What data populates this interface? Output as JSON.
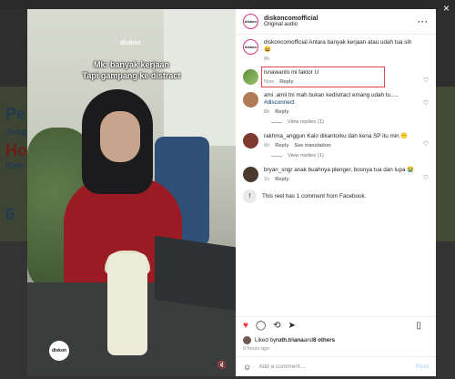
{
  "background": {
    "left_text": [
      "Pe",
      "Jang",
      "Hos",
      "Kam",
      "6"
    ]
  },
  "close_icon": "×",
  "video": {
    "logo_top": "diskon",
    "caption_line1": "Mk: banyak kerjaan",
    "caption_line2": "Tapi gampang ke distract",
    "logo_bottom": "diskon"
  },
  "header": {
    "username": "diskoncomofficial",
    "audio": "Original audio",
    "more": "···"
  },
  "comments": [
    {
      "avatar": "diskon",
      "avatar_style": "",
      "text_user": "diskoncomofficial",
      "text": "Antara banyak kerjaan atau udah tua sih 😆",
      "time": "9h",
      "reply": "",
      "translate": "",
      "liked": false
    },
    {
      "avatar": "",
      "avatar_style": "green",
      "text_user": "isnawanto",
      "text": "ini faktor U",
      "time": "Now",
      "reply": "Reply",
      "translate": "",
      "highlight": true
    },
    {
      "avatar": "",
      "avatar_style": "photo",
      "text_user": "ami",
      "text": ".amii tni mah bukan kedistract emang udah tu.....",
      "hashtag": "#disconnect",
      "time": "8h",
      "reply": "Reply",
      "translate": "",
      "view_replies": "View replies (1)"
    },
    {
      "avatar": "",
      "avatar_style": "red",
      "text_user": "rakhma_anggun",
      "text": "Kalo dikantorku dah kena SP itu min 😶",
      "time": "6h",
      "reply": "Reply",
      "translate": "See translation",
      "view_replies": "View replies (1)"
    },
    {
      "avatar": "",
      "avatar_style": "brown",
      "text_user": "bryan_sngr",
      "text": "anak buahnya plenger, bosnya tua dan lupa 😭",
      "time": "1h",
      "reply": "Reply",
      "translate": ""
    }
  ],
  "fb_note": "This reel has 1 comment from Facebook.",
  "likes": {
    "prefix": "Liked by ",
    "user": "ruth.triana",
    "and": " and ",
    "others": "8 others"
  },
  "time_ago": "9 hours ago",
  "add_comment": {
    "placeholder": "Add a comment…",
    "post": "Post"
  }
}
